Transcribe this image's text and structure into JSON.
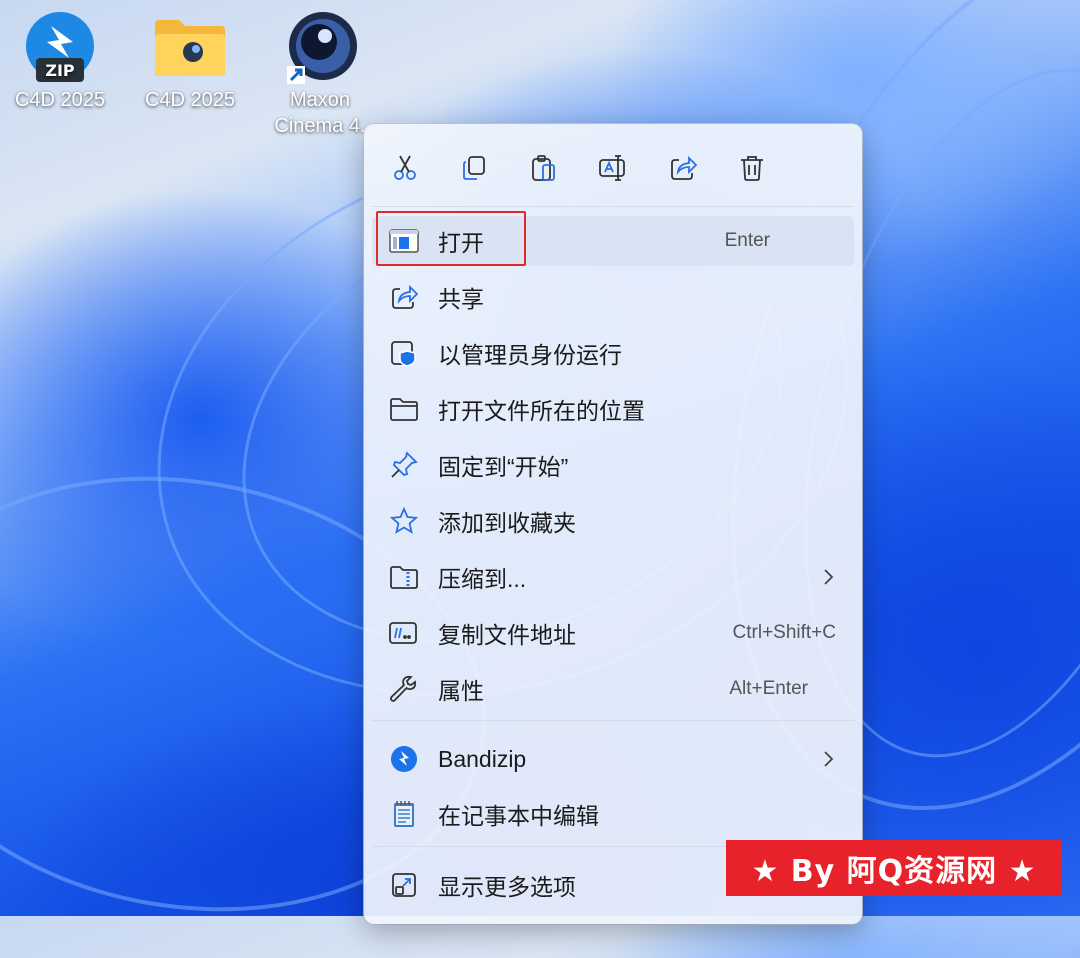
{
  "desktop": {
    "icons": [
      {
        "label": "C4D 2025",
        "badge": "ZIP",
        "icon": "bandizip-archive-icon"
      },
      {
        "label": "C4D 2025",
        "icon": "folder-icon"
      },
      {
        "label_line1": "Maxon",
        "label_line2": "Cinema 4.",
        "icon": "cinema4d-shortcut-icon"
      }
    ]
  },
  "context_menu": {
    "toolbar": [
      {
        "name": "cut",
        "icon": "scissors-icon"
      },
      {
        "name": "copy",
        "icon": "copy-icon"
      },
      {
        "name": "paste",
        "icon": "paste-icon"
      },
      {
        "name": "rename",
        "icon": "rename-icon"
      },
      {
        "name": "share",
        "icon": "share-icon"
      },
      {
        "name": "delete",
        "icon": "trash-icon"
      }
    ],
    "items": [
      {
        "label": "打开",
        "shortcut": "Enter",
        "icon": "window-app-icon"
      },
      {
        "label": "共享",
        "icon": "share-icon"
      },
      {
        "label": "以管理员身份运行",
        "icon": "shield-icon"
      },
      {
        "label": "打开文件所在的位置",
        "icon": "folder-outline-icon"
      },
      {
        "label": "固定到“开始”",
        "icon": "pin-icon"
      },
      {
        "label": "添加到收藏夹",
        "icon": "star-icon"
      },
      {
        "label": "压缩到...",
        "icon": "zip-folder-icon"
      },
      {
        "label": "复制文件地址",
        "shortcut": "Ctrl+Shift+C",
        "icon": "path-icon"
      },
      {
        "label": "属性",
        "shortcut": "Alt+Enter",
        "icon": "wrench-icon"
      },
      {
        "label": "Bandizip",
        "icon": "bandizip-icon"
      },
      {
        "label": "在记事本中编辑",
        "icon": "notepad-icon"
      },
      {
        "label": "显示更多选项",
        "icon": "expand-icon"
      }
    ]
  },
  "watermark": {
    "text": "★ By 阿Q资源网 ★"
  },
  "colors": {
    "accent": "#1a73e8",
    "highlight_border": "#e02a2a",
    "watermark_bg": "#e8222b"
  }
}
